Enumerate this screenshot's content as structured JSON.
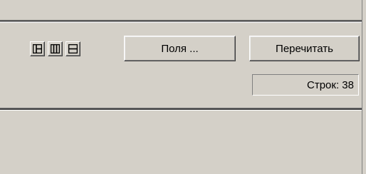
{
  "toolbar": {
    "icons": [
      "layout-left-panel-icon",
      "layout-columns-icon",
      "layout-rows-icon"
    ],
    "fields_label": "Поля ...",
    "refresh_label": "Перечитать"
  },
  "status": {
    "rows_text": "Строк: 38"
  }
}
